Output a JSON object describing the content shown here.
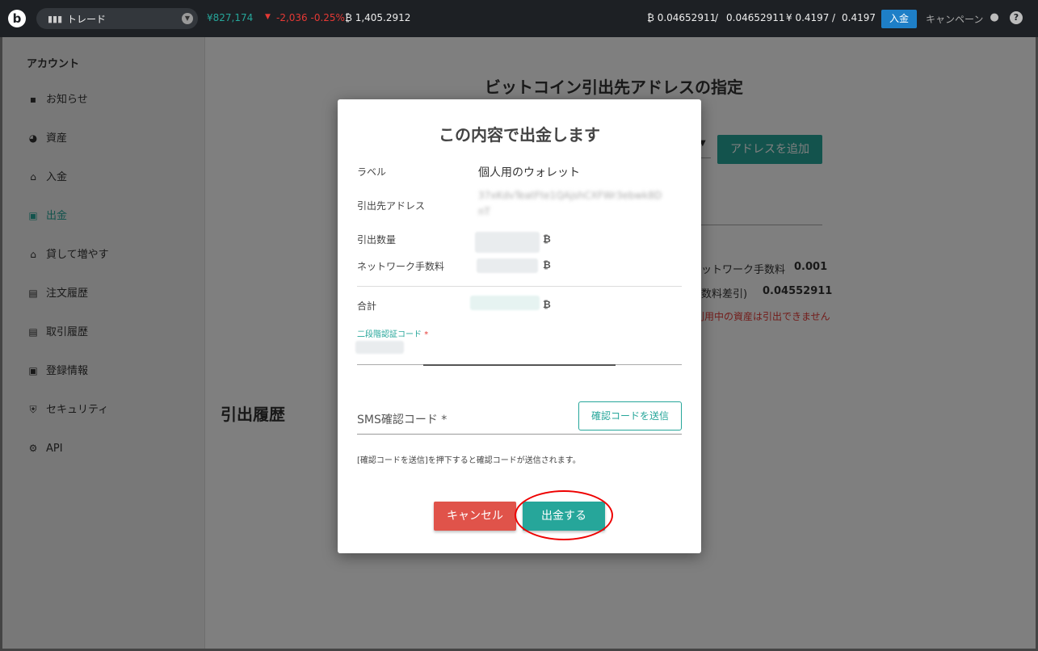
{
  "topbar": {
    "logo": "b",
    "trade_label": "トレード",
    "jpy_price": "¥827,174",
    "change": "-2,036 -0.25%",
    "btc_amount": "₿ 1,405.2912",
    "btc_balance": "₿ 0.04652911",
    "btc_balance2": "0.04652911",
    "jpy_balance": "¥ 0.4197",
    "jpy_balance2": "0.4197",
    "separator": "/",
    "deposit": "入金",
    "campaign": "キャンペーン",
    "icons": [
      "chart-icon",
      "chevron-down-icon",
      "triangle-down-icon",
      "user-icon",
      "help-icon"
    ]
  },
  "sidebar": {
    "title": "アカウント",
    "items": [
      {
        "label": "お知らせ",
        "icon": "message-icon",
        "glyph": "▪"
      },
      {
        "label": "資産",
        "icon": "pie-chart-icon",
        "glyph": "◕"
      },
      {
        "label": "入金",
        "icon": "bank-icon",
        "glyph": "⌂"
      },
      {
        "label": "出金",
        "icon": "wallet-icon",
        "glyph": "▣",
        "active": true
      },
      {
        "label": "貸して増やす",
        "icon": "bank-icon",
        "glyph": "⌂"
      },
      {
        "label": "注文履歴",
        "icon": "clipboard-icon",
        "glyph": "▤"
      },
      {
        "label": "取引履歴",
        "icon": "document-icon",
        "glyph": "▤"
      },
      {
        "label": "登録情報",
        "icon": "id-card-icon",
        "glyph": "▣"
      },
      {
        "label": "セキュリティ",
        "icon": "shield-icon",
        "glyph": "⛨"
      },
      {
        "label": "API",
        "icon": "gear-icon",
        "glyph": "⚙"
      }
    ],
    "active_color": "#26a69a"
  },
  "background": {
    "title": "ビットコイン引出先アドレスの指定",
    "add_address": "アドレスを追加",
    "fee_label": "ットワーク手数料",
    "fee_value": "0.001",
    "net_label": "数料差引)",
    "net_value": "0.04552911",
    "warning": "利用中の資産は引出できません",
    "history_title": "引出履歴"
  },
  "modal": {
    "title": "この内容で出金します",
    "label_key": "ラベル",
    "label_value": "個人用のウォレット",
    "address_key": "引出先アドレス",
    "address_value": "37xKdvTeatFte1QAjshCXFWr3ebwk8D",
    "address_value2": "nT",
    "amount_key": "引出数量",
    "fee_key": "ネットワーク手数料",
    "total_key": "合計",
    "btc_symbol": "₿",
    "tfa_label": "二段階認証コード",
    "required_mark": "*",
    "sms_label": "SMS確認コード *",
    "send_code": "確認コードを送信",
    "note": "[確認コードを送信]を押下すると確認コードが送信されます。",
    "cancel": "キャンセル",
    "submit": "出金する"
  },
  "colors": {
    "accent": "#26a69a",
    "cancel": "#e0534a",
    "deposit": "#1e7fc7",
    "highlight_circle": "#e00000"
  }
}
